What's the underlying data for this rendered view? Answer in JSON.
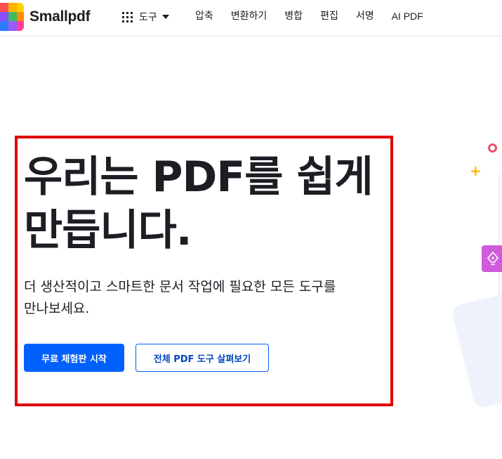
{
  "header": {
    "brand": "Smallpdf",
    "tools_label": "도구",
    "nav": [
      {
        "label": "압축"
      },
      {
        "label": "변환하기"
      },
      {
        "label": "병합"
      },
      {
        "label": "편집"
      },
      {
        "label": "서명"
      },
      {
        "label": "AI PDF"
      }
    ]
  },
  "hero": {
    "title_line1": "우리는 PDF를 쉽게",
    "title_line2": "만듭니다.",
    "subtitle_line1": "더 생산적이고 스마트한 문서 작업에 필요한 모든 도구를",
    "subtitle_line2": "만나보세요.",
    "primary_button": "무료 체험판 시작",
    "secondary_button": "전체 PDF 도구 살펴보기"
  },
  "colors": {
    "accent": "#0061fe",
    "highlight_box": "#e00000",
    "text": "#1d1d24"
  }
}
